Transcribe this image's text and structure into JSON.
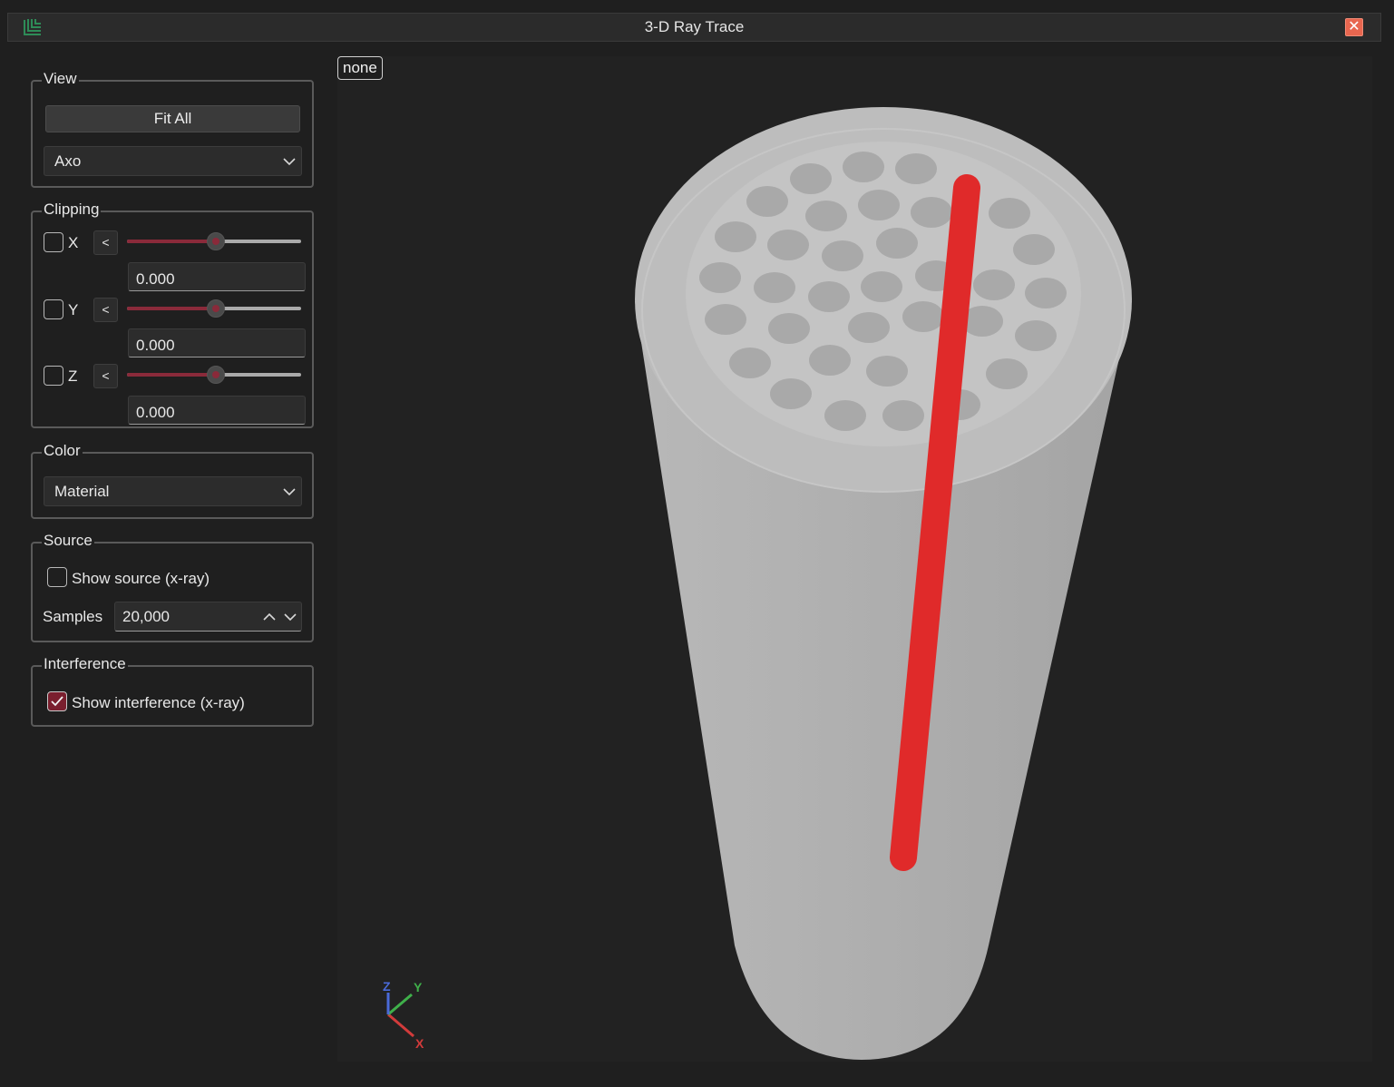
{
  "window": {
    "title": "3-D Ray Trace",
    "close_symbol": "✕"
  },
  "view": {
    "legend": "View",
    "fit_all_label": "Fit All",
    "projection": "Axo"
  },
  "clipping": {
    "legend": "Clipping",
    "axes": [
      {
        "label": "X",
        "checked": false,
        "direction": "<",
        "value": "0.000",
        "slider_fraction": 0.5
      },
      {
        "label": "Y",
        "checked": false,
        "direction": "<",
        "value": "0.000",
        "slider_fraction": 0.5
      },
      {
        "label": "Z",
        "checked": false,
        "direction": "<",
        "value": "0.000",
        "slider_fraction": 0.5
      }
    ]
  },
  "color": {
    "legend": "Color",
    "mode": "Material"
  },
  "source": {
    "legend": "Source",
    "show_source_label": "Show source (x-ray)",
    "show_source_checked": false,
    "samples_label": "Samples",
    "samples_value": "20,000"
  },
  "interference": {
    "legend": "Interference",
    "show_interference_label": "Show interference (x-ray)",
    "show_interference_checked": true
  },
  "viewport": {
    "selection_tag": "none",
    "triad": {
      "x": "X",
      "y": "Y",
      "z": "Z"
    }
  },
  "colors": {
    "accent": "#8a2a3a",
    "interference": "#e02a2a",
    "body": "#b4b4b4",
    "triad_x": "#d23b3b",
    "triad_y": "#3fb04a",
    "triad_z": "#4a6ad8",
    "app_icon": "#2e8b57"
  }
}
